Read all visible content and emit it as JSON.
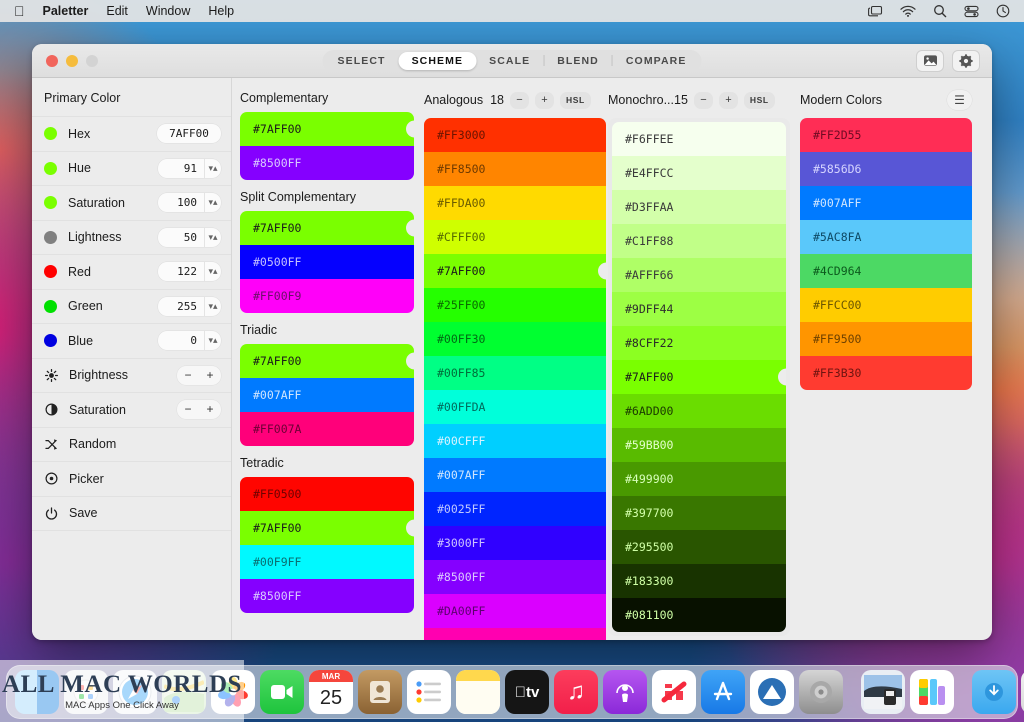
{
  "menubar": {
    "apple_icon": "apple-icon",
    "items": [
      {
        "label": "Paletter",
        "bold": true
      },
      {
        "label": "Edit",
        "bold": false
      },
      {
        "label": "Window",
        "bold": false
      },
      {
        "label": "Help",
        "bold": false
      }
    ],
    "status_icons": [
      "screen-mirroring-icon",
      "wifi-icon",
      "search-icon",
      "control-center-icon",
      "clock-icon"
    ]
  },
  "window": {
    "tabs": [
      {
        "label": "SELECT",
        "active": false
      },
      {
        "label": "SCHEME",
        "active": true
      },
      {
        "label": "SCALE",
        "active": false
      },
      {
        "label": "BLEND",
        "active": false
      },
      {
        "label": "COMPARE",
        "active": false
      }
    ],
    "toolbar": {
      "image_button": "image-icon",
      "settings_button": "gear-icon"
    }
  },
  "sidebar": {
    "title": "Primary Color",
    "rows": [
      {
        "label": "Hex",
        "value": "7AFF00",
        "dot": "#7AFF00",
        "type": "hex"
      },
      {
        "label": "Hue",
        "value": "91",
        "dot": "#7AFF00",
        "type": "stepper"
      },
      {
        "label": "Saturation",
        "value": "100",
        "dot": "#7AFF00",
        "type": "stepper"
      },
      {
        "label": "Lightness",
        "value": "50",
        "dot": "#808080",
        "type": "stepper"
      },
      {
        "label": "Red",
        "value": "122",
        "dot": "#FF0000",
        "type": "stepper"
      },
      {
        "label": "Green",
        "value": "255",
        "dot": "#00E000",
        "type": "stepper"
      },
      {
        "label": "Blue",
        "value": "0",
        "dot": "#0000E0",
        "type": "stepper"
      }
    ],
    "actions": [
      {
        "label": "Brightness",
        "icon": "brightness-icon",
        "controls": [
          "−",
          "+"
        ]
      },
      {
        "label": "Saturation",
        "icon": "saturation-icon",
        "controls": [
          "−",
          "+"
        ]
      },
      {
        "label": "Random",
        "icon": "shuffle-icon",
        "controls": []
      },
      {
        "label": "Picker",
        "icon": "picker-icon",
        "controls": []
      },
      {
        "label": "Save",
        "icon": "power-icon",
        "controls": []
      }
    ]
  },
  "schemes": [
    {
      "title": "Complementary",
      "swatches": [
        {
          "hex": "#7AFF00",
          "text": "#1b1b1b",
          "selected": true
        },
        {
          "hex": "#8500FF",
          "text": "#d8c8ff",
          "selected": false
        }
      ]
    },
    {
      "title": "Split Complementary",
      "swatches": [
        {
          "hex": "#7AFF00",
          "text": "#1b1b1b",
          "selected": true
        },
        {
          "hex": "#0500FF",
          "text": "#c3c0ff",
          "selected": false
        },
        {
          "hex": "#FF00F9",
          "text": "#6b1068",
          "selected": false
        }
      ]
    },
    {
      "title": "Triadic",
      "swatches": [
        {
          "hex": "#7AFF00",
          "text": "#1b1b1b",
          "selected": true
        },
        {
          "hex": "#007AFF",
          "text": "#cfe5ff",
          "selected": false
        },
        {
          "hex": "#FF007A",
          "text": "#6d0035",
          "selected": false
        }
      ]
    },
    {
      "title": "Tetradic",
      "swatches": [
        {
          "hex": "#FF0500",
          "text": "#6e0200",
          "selected": false
        },
        {
          "hex": "#7AFF00",
          "text": "#1b1b1b",
          "selected": true
        },
        {
          "hex": "#00F9FF",
          "text": "#0a6e71",
          "selected": false
        },
        {
          "hex": "#8500FF",
          "text": "#d8c8ff",
          "selected": false
        }
      ]
    }
  ],
  "analogous": {
    "title": "Analogous",
    "count": "18",
    "decrement": "−",
    "increment": "+",
    "mode": "HSL",
    "swatches": [
      {
        "hex": "#FF3000",
        "text": "#6b1400",
        "selected": false
      },
      {
        "hex": "#FF8500",
        "text": "#6e3a00",
        "selected": false
      },
      {
        "hex": "#FFDA00",
        "text": "#6b5c00",
        "selected": false
      },
      {
        "hex": "#CFFF00",
        "text": "#556b00",
        "selected": false
      },
      {
        "hex": "#7AFF00",
        "text": "#1b1b1b",
        "selected": true
      },
      {
        "hex": "#25FF00",
        "text": "#0a6b00",
        "selected": false
      },
      {
        "hex": "#00FF30",
        "text": "#006b14",
        "selected": false
      },
      {
        "hex": "#00FF85",
        "text": "#006e3a",
        "selected": false
      },
      {
        "hex": "#00FFDA",
        "text": "#006b5c",
        "selected": false
      },
      {
        "hex": "#00CFFF",
        "text": "#d8f2ff",
        "selected": false
      },
      {
        "hex": "#007AFF",
        "text": "#cfe5ff",
        "selected": false
      },
      {
        "hex": "#0025FF",
        "text": "#c0c8ff",
        "selected": false
      },
      {
        "hex": "#3000FF",
        "text": "#ccc2ff",
        "selected": false
      },
      {
        "hex": "#8500FF",
        "text": "#dcc8ff",
        "selected": false
      },
      {
        "hex": "#DA00FF",
        "text": "#5d0070",
        "selected": false
      }
    ]
  },
  "monochrome": {
    "title": "Monochro...",
    "count": "15",
    "decrement": "−",
    "increment": "+",
    "mode": "HSL",
    "swatches": [
      {
        "hex": "#F6FFEE",
        "text": "#3a3a3a",
        "selected": false
      },
      {
        "hex": "#E4FFCC",
        "text": "#3a3a3a",
        "selected": false
      },
      {
        "hex": "#D3FFAA",
        "text": "#3a3a3a",
        "selected": false
      },
      {
        "hex": "#C1FF88",
        "text": "#3a3a3a",
        "selected": false
      },
      {
        "hex": "#AFFF66",
        "text": "#3a3a3a",
        "selected": false
      },
      {
        "hex": "#9DFF44",
        "text": "#2e2e2e",
        "selected": false
      },
      {
        "hex": "#8CFF22",
        "text": "#2a2a2a",
        "selected": false
      },
      {
        "hex": "#7AFF00",
        "text": "#1b1b1b",
        "selected": true
      },
      {
        "hex": "#6ADD00",
        "text": "#1b3a00",
        "selected": false
      },
      {
        "hex": "#59BB00",
        "text": "#e4ffcc",
        "selected": false
      },
      {
        "hex": "#499900",
        "text": "#d8ffbb",
        "selected": false
      },
      {
        "hex": "#397700",
        "text": "#d3ffaa",
        "selected": false
      },
      {
        "hex": "#295500",
        "text": "#cfffa5",
        "selected": false
      },
      {
        "hex": "#183300",
        "text": "#cfffa5",
        "selected": false
      },
      {
        "hex": "#081100",
        "text": "#cfffa5",
        "selected": false
      }
    ]
  },
  "modern": {
    "title": "Modern Colors",
    "menu_icon": "hamburger-icon",
    "swatches": [
      {
        "hex": "#FF2D55",
        "text": "#6e0a22",
        "selected": false
      },
      {
        "hex": "#5856D6",
        "text": "#d5d4ff",
        "selected": false
      },
      {
        "hex": "#007AFF",
        "text": "#cfe5ff",
        "selected": false
      },
      {
        "hex": "#5AC8FA",
        "text": "#0e4a66",
        "selected": false
      },
      {
        "hex": "#4CD964",
        "text": "#0c5a1d",
        "selected": false
      },
      {
        "hex": "#FFCC00",
        "text": "#6b5600",
        "selected": false
      },
      {
        "hex": "#FF9500",
        "text": "#6e4100",
        "selected": false
      },
      {
        "hex": "#FF3B30",
        "text": "#6e1410",
        "selected": false
      }
    ]
  },
  "dock": {
    "apps": [
      {
        "name": "finder",
        "label": "Finder"
      },
      {
        "name": "launchpad",
        "label": "Launchpad"
      },
      {
        "name": "safari",
        "label": "Safari"
      },
      {
        "name": "maps",
        "label": "Maps"
      },
      {
        "name": "photos",
        "label": "Photos"
      },
      {
        "name": "facetime",
        "label": "FaceTime"
      },
      {
        "name": "calendar",
        "label": "Calendar",
        "month": "MAR",
        "day": "25"
      },
      {
        "name": "contacts",
        "label": "Contacts"
      },
      {
        "name": "reminders",
        "label": "Reminders"
      },
      {
        "name": "notes",
        "label": "Notes"
      },
      {
        "name": "appletv",
        "label": "Apple TV"
      },
      {
        "name": "music",
        "label": "Music"
      },
      {
        "name": "podcasts",
        "label": "Podcasts"
      },
      {
        "name": "news",
        "label": "News"
      },
      {
        "name": "appstore",
        "label": "App Store"
      },
      {
        "name": "preview",
        "label": "Preview"
      },
      {
        "name": "system-preferences",
        "label": "System Preferences"
      },
      {
        "name": "image-capture",
        "label": "Image Capture"
      },
      {
        "name": "paletter",
        "label": "Paletter"
      },
      {
        "name": "downloads-folder",
        "label": "Downloads"
      },
      {
        "name": "trash",
        "label": "Trash"
      }
    ]
  },
  "watermark": {
    "main": "ALL MAC WORLDS",
    "sub": "MAC Apps One Click Away"
  }
}
